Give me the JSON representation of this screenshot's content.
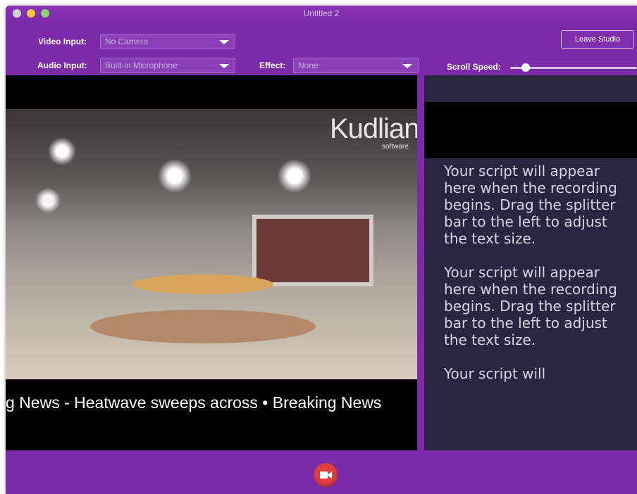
{
  "window": {
    "title": "Untitled 2"
  },
  "toolbar": {
    "video_input_label": "Video Input:",
    "video_input_value": "No Camera",
    "audio_input_label": "Audio Input:",
    "audio_input_value": "Built-in Microphone",
    "effect_label": "Effect:",
    "effect_value": "None",
    "leave_label": "Leave Studio",
    "scroll_speed_label": "Scroll Speed:",
    "scroll_speed_level": 0.12
  },
  "video": {
    "brand": "Kudlian",
    "brand_sub": "software",
    "ticker": "g News - Heatwave sweeps across • Breaking News"
  },
  "script": {
    "paragraphs": [
      "Your script will appear here when the recording begins. Drag the splitter bar to the left to adjust the text size.",
      "Your script will appear here when the recording begins. Drag the splitter bar to the left to adjust the text size.",
      "Your script will"
    ]
  },
  "colors": {
    "window_bg": "#7b2aa8",
    "record": "#e04040",
    "script_bg": "#2a2540"
  }
}
